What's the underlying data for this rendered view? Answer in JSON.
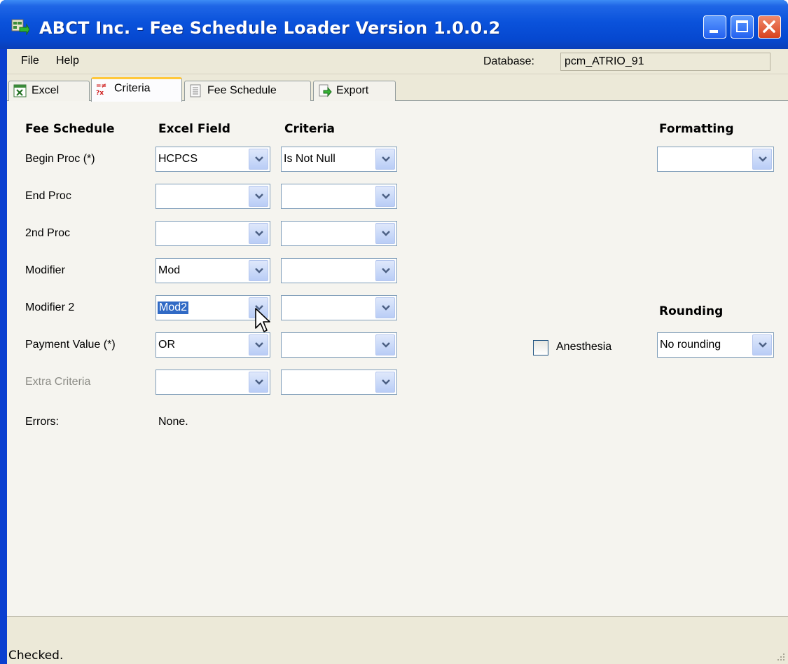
{
  "window": {
    "title": "ABCT Inc. - Fee Schedule Loader Version 1.0.0.2"
  },
  "menu": {
    "file": "File",
    "help": "Help"
  },
  "database": {
    "label": "Database:",
    "value": "pcm_ATRIO_91"
  },
  "tabs": [
    {
      "label": "Excel",
      "icon": "excel-icon"
    },
    {
      "label": "Criteria",
      "icon": "criteria-icon"
    },
    {
      "label": "Fee Schedule",
      "icon": "fee-schedule-icon"
    },
    {
      "label": "Export",
      "icon": "export-icon"
    }
  ],
  "active_tab": "Criteria",
  "headers": {
    "fee_schedule": "Fee Schedule",
    "excel_field": "Excel Field",
    "criteria": "Criteria",
    "formatting": "Formatting",
    "rounding": "Rounding"
  },
  "rows": [
    {
      "label": "Begin Proc (*)",
      "excel_field": "HCPCS",
      "criteria": "Is Not Null",
      "enabled": true
    },
    {
      "label": "End Proc",
      "excel_field": "",
      "criteria": "",
      "enabled": true
    },
    {
      "label": "2nd Proc",
      "excel_field": "",
      "criteria": "",
      "enabled": true
    },
    {
      "label": "Modifier",
      "excel_field": "Mod",
      "criteria": "",
      "enabled": true
    },
    {
      "label": "Modifier 2",
      "excel_field": "Mod2",
      "criteria": "",
      "enabled": true,
      "selected": true
    },
    {
      "label": "Payment Value (*)",
      "excel_field": "OR",
      "criteria": "",
      "enabled": true
    },
    {
      "label": "Extra Criteria",
      "excel_field": "",
      "criteria": "",
      "enabled": false
    }
  ],
  "formatting": {
    "value": ""
  },
  "rounding": {
    "value": "No rounding"
  },
  "anesthesia": {
    "label": "Anesthesia",
    "checked": false
  },
  "errors": {
    "label": "Errors:",
    "value": "None."
  },
  "status": {
    "text": "Checked."
  },
  "colors": {
    "titlebar": "#0a52db",
    "selection": "#316ac5",
    "close_button": "#d8421e",
    "active_tab_accent": "#ffc83c"
  }
}
